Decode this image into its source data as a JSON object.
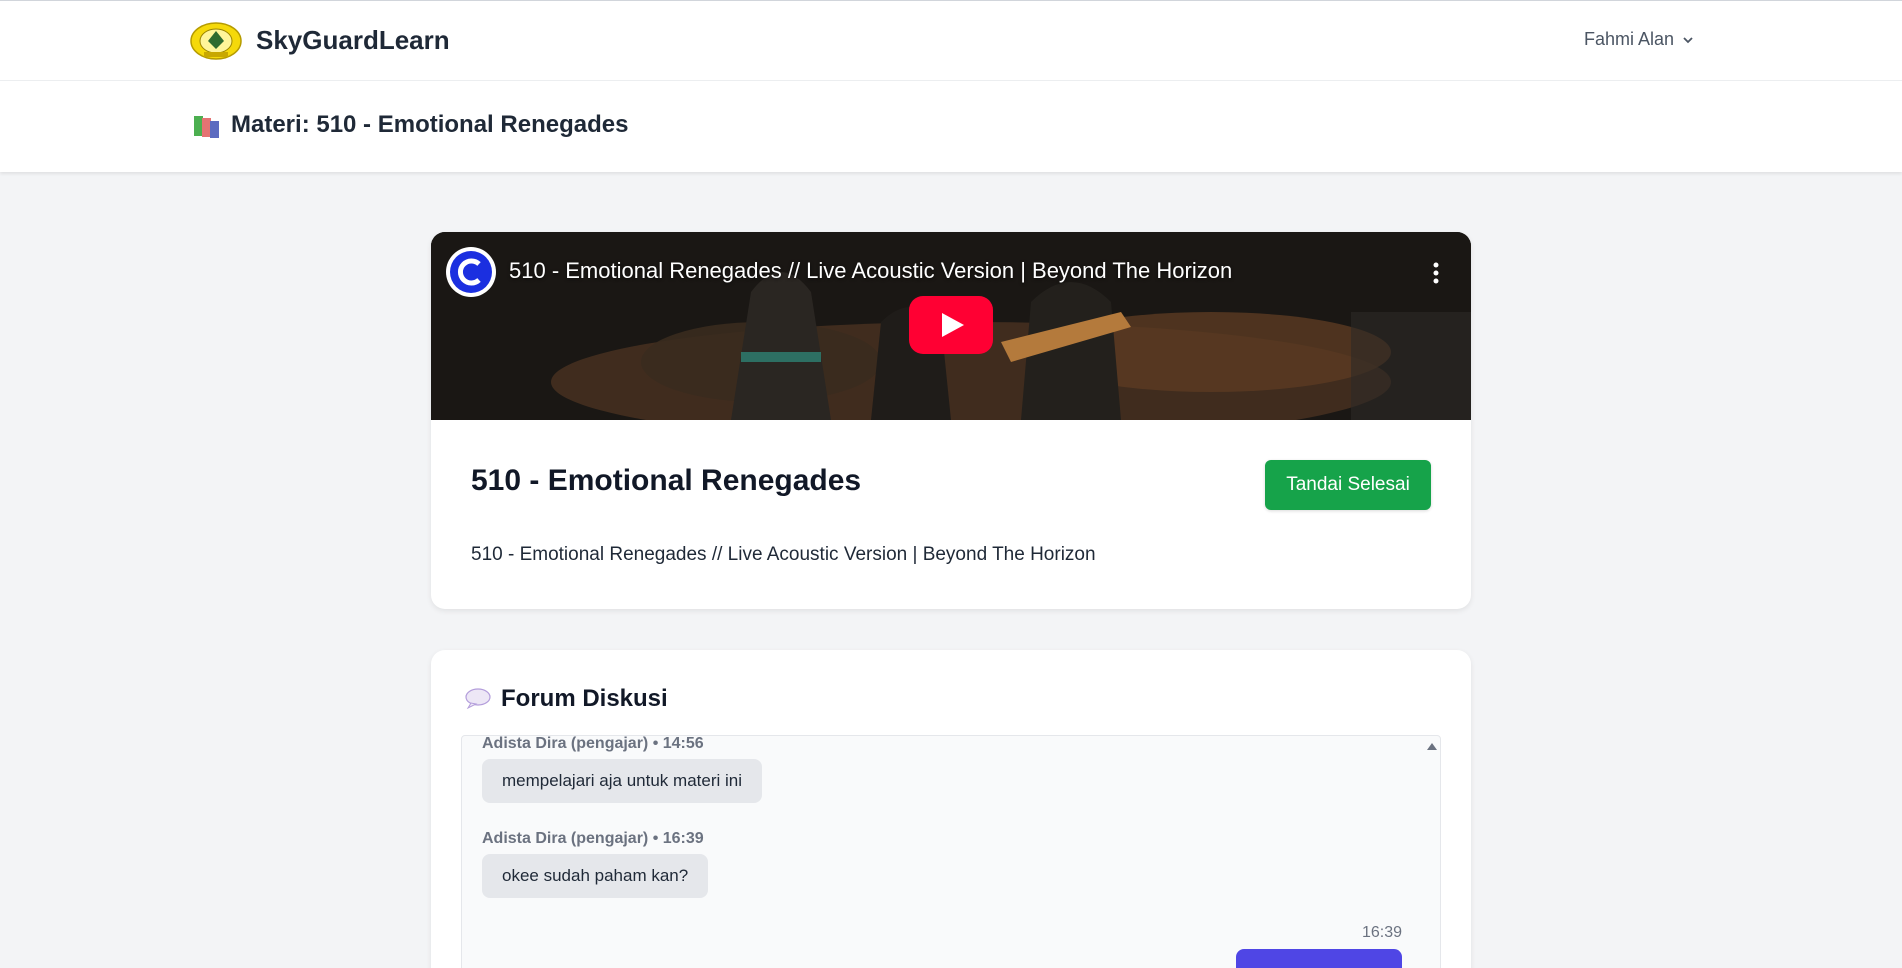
{
  "nav": {
    "brand": "SkyGuardLearn",
    "user_name": "Fahmi Alan"
  },
  "header": {
    "title": "Materi: 510 - Emotional Renegades"
  },
  "video": {
    "embed_title": "510 - Emotional Renegades // Live Acoustic Version | Beyond The Horizon"
  },
  "material": {
    "title": "510 - Emotional Renegades",
    "done_button": "Tandai Selesai",
    "description": "510 - Emotional Renegades // Live Acoustic Version | Beyond The Horizon"
  },
  "forum": {
    "title": "Forum Diskusi",
    "messages": [
      {
        "meta": "Adista Dira (pengajar) • 14:56",
        "text": "mempelajari aja untuk materi ini"
      },
      {
        "meta": "Adista Dira (pengajar) • 16:39",
        "text": "okee sudah paham kan?"
      }
    ],
    "own_message_time": "16:39"
  },
  "colors": {
    "primary_green": "#16a34a",
    "own_bubble": "#4f46e5",
    "youtube_red": "#ff0033"
  },
  "icons": {
    "logo": "emblem-logo",
    "header": "books-icon",
    "forum": "speech-bubble-icon"
  }
}
